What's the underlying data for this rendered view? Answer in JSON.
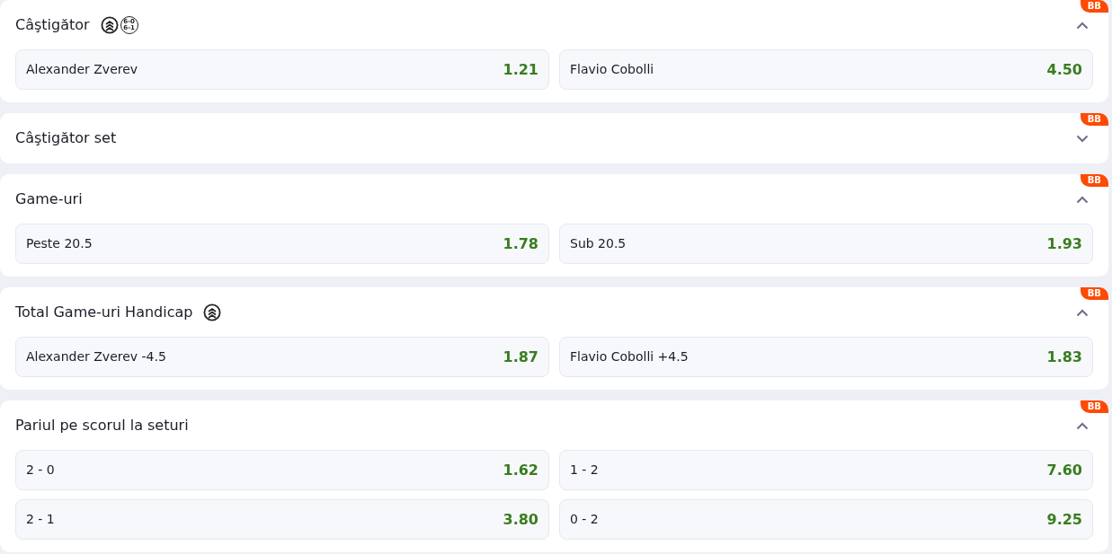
{
  "markets": [
    {
      "title": "Câştigător",
      "badge": "BB",
      "expanded": true,
      "icons": [
        {
          "kind": "boost"
        },
        {
          "kind": "score",
          "lines": [
            "6-0",
            "6-1"
          ]
        }
      ],
      "outcomes": [
        {
          "label": "Alexander Zverev",
          "odds": "1.21"
        },
        {
          "label": "Flavio Cobolli",
          "odds": "4.50"
        }
      ]
    },
    {
      "title": "Câştigător set",
      "badge": "BB",
      "expanded": false
    },
    {
      "title": "Game-uri",
      "badge": "BB",
      "expanded": true,
      "outcomes": [
        {
          "label": "Peste 20.5",
          "odds": "1.78"
        },
        {
          "label": "Sub 20.5",
          "odds": "1.93"
        }
      ]
    },
    {
      "title": "Total Game-uri Handicap",
      "badge": "BB",
      "expanded": true,
      "icons": [
        {
          "kind": "boost"
        }
      ],
      "outcomes": [
        {
          "label": "Alexander Zverev -4.5",
          "odds": "1.87"
        },
        {
          "label": "Flavio Cobolli +4.5",
          "odds": "1.83"
        }
      ]
    },
    {
      "title": "Pariul pe scorul la seturi",
      "badge": "BB",
      "expanded": true,
      "outcomes": [
        {
          "label": "2 - 0",
          "odds": "1.62"
        },
        {
          "label": "1 - 2",
          "odds": "7.60"
        },
        {
          "label": "2 - 1",
          "odds": "3.80"
        },
        {
          "label": "0 - 2",
          "odds": "9.25"
        }
      ]
    }
  ]
}
